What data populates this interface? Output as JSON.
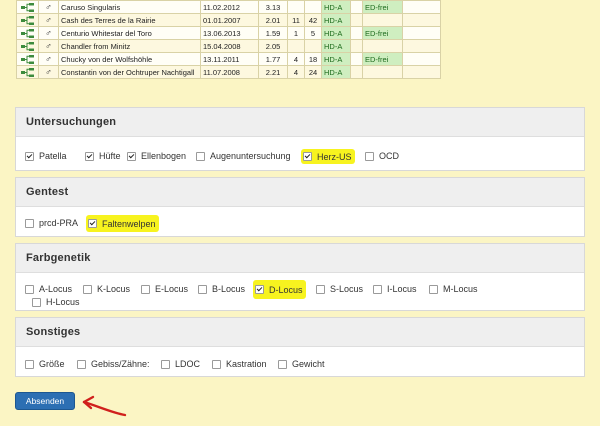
{
  "results": {
    "rows": [
      {
        "name": "Caruso Singularis",
        "date": "11.02.2012",
        "v1": "3.13",
        "v2": "",
        "v3": "",
        "hd": "",
        "ed": ""
      },
      {
        "name": "Cash des Terres de la Rairie",
        "date": "01.01.2007",
        "v1": "2.01",
        "v2": "11",
        "v3": "42",
        "hd": "HD-A",
        "ed": ""
      },
      {
        "name": "Centurio Whitestar del Toro",
        "date": "13.06.2013",
        "v1": "1.59",
        "v2": "1",
        "v3": "5",
        "hd": "HD-A",
        "ed": "ED-frei"
      },
      {
        "name": "Chandler from Minitz",
        "date": "15.04.2008",
        "v1": "2.05",
        "v2": "",
        "v3": "",
        "hd": "HD-A",
        "ed": ""
      },
      {
        "name": "Chucky von der Wolfshöhle",
        "date": "13.11.2011",
        "v1": "1.77",
        "v2": "4",
        "v3": "18",
        "hd": "HD-A",
        "ed": "ED-frei"
      },
      {
        "name": "Constantin von der Ochtruper Nachtigall",
        "date": "11.07.2008",
        "v1": "2.21",
        "v2": "4",
        "v3": "24",
        "hd": "HD-A",
        "ed": ""
      }
    ],
    "first_row_ed": "ED-frei",
    "first_row_hd": "HD-A",
    "sex_symbol": "♂"
  },
  "untersuchungen": {
    "title": "Untersuchungen",
    "options": [
      {
        "label": "Patella",
        "checked": true
      },
      {
        "label": "Hüfte",
        "checked": true
      },
      {
        "label": "Ellenbogen",
        "checked": true
      },
      {
        "label": "Augenuntersuchung",
        "checked": false
      },
      {
        "label": "Herz-US",
        "checked": true
      },
      {
        "label": "OCD",
        "checked": false
      }
    ]
  },
  "gentest": {
    "title": "Gentest",
    "options": [
      {
        "label": "prcd-PRA",
        "checked": false
      },
      {
        "label": "Faltenwelpen",
        "checked": true
      }
    ]
  },
  "farbgenetik": {
    "title": "Farbgenetik",
    "options": [
      {
        "label": "A-Locus",
        "checked": false
      },
      {
        "label": "K-Locus",
        "checked": false
      },
      {
        "label": "E-Locus",
        "checked": false
      },
      {
        "label": "B-Locus",
        "checked": false
      },
      {
        "label": "D-Locus",
        "checked": true
      },
      {
        "label": "S-Locus",
        "checked": false
      },
      {
        "label": "I-Locus",
        "checked": false
      },
      {
        "label": "M-Locus",
        "checked": false
      },
      {
        "label": "H-Locus",
        "checked": false
      }
    ]
  },
  "sonstiges": {
    "title": "Sonstiges",
    "options": [
      {
        "label": "Größe",
        "checked": false
      },
      {
        "label": "Gebiss/Zähne:",
        "checked": false
      },
      {
        "label": "LDOC",
        "checked": false
      },
      {
        "label": "Kastration",
        "checked": false
      },
      {
        "label": "Gewicht",
        "checked": false
      }
    ]
  },
  "submit_label": "Absenden",
  "colors": {
    "page_bg": "#fbf5c4",
    "highlight": "#f7f31f",
    "button": "#2c6fb3",
    "arrow": "#d0201c",
    "status_green": "#cfeec0"
  }
}
